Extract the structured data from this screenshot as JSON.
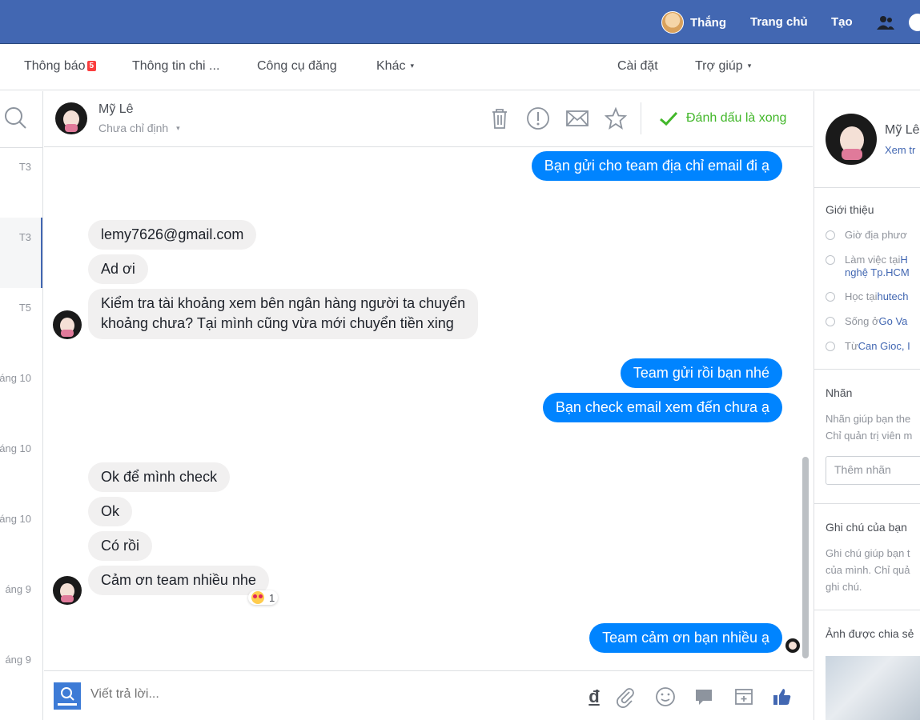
{
  "topbar": {
    "user_name": "Thắng",
    "nav": [
      "Trang chủ",
      "Tạo"
    ]
  },
  "subnav": {
    "items": [
      {
        "label": "Thông báo",
        "badge": "5"
      },
      {
        "label": "Thông tin chi ..."
      },
      {
        "label": "Công cụ đăng"
      },
      {
        "label": "Khác",
        "caret": "▾"
      },
      {
        "label": "Cài đặt"
      },
      {
        "label": "Trợ giúp",
        "caret": "▾"
      }
    ]
  },
  "threadlist": {
    "dates": [
      "T3",
      "T3",
      "T5",
      "áng 10",
      "áng 10",
      "áng 10",
      "áng 9",
      "áng 9"
    ]
  },
  "chat": {
    "contact_name": "Mỹ Lê",
    "assign_label": "Chưa chỉ định",
    "assign_caret": "▾",
    "mark_done": "Đánh dấu là xong"
  },
  "messages": [
    {
      "dir": "out",
      "text": "Bạn gửi cho team địa chỉ email đi ạ"
    },
    {
      "dir": "in",
      "text": "lemy7626@gmail.com"
    },
    {
      "dir": "in",
      "text": "Ad ơi"
    },
    {
      "dir": "in",
      "text": "Kiểm tra tài khoảng xem bên ngân hàng người ta chuyển"
    },
    {
      "dir": "in",
      "text": "khoảng chưa? Tại mình cũng vừa mới chuyển tiền xing"
    },
    {
      "dir": "out",
      "text": "Team gửi rồi bạn nhé"
    },
    {
      "dir": "out",
      "text": "Bạn check email xem đến chưa ạ"
    },
    {
      "dir": "in",
      "text": "Ok để mình check"
    },
    {
      "dir": "in",
      "text": "Ok"
    },
    {
      "dir": "in",
      "text": "Có rồi"
    },
    {
      "dir": "in",
      "text": "Cảm ơn team nhiều nhe"
    },
    {
      "dir": "out",
      "text": "Team cảm ơn bạn nhiều ạ"
    }
  ],
  "reaction": {
    "count": "1"
  },
  "composer": {
    "placeholder": "Viết trả lời...",
    "currency_symbol": "đ"
  },
  "profile": {
    "name": "Mỹ Lê",
    "link": "Xem tr",
    "intro_title": "Giới thiệu",
    "intro": [
      {
        "prefix": "Giờ địa phươ",
        "link": ""
      },
      {
        "prefix": "Làm việc tại ",
        "link": "H"
      },
      {
        "prefix": "",
        "link": "nghệ Tp.HCM"
      },
      {
        "prefix": "Học tại ",
        "link": "hutech"
      },
      {
        "prefix": "Sống ở ",
        "link": "Go Va"
      },
      {
        "prefix": "Từ ",
        "link": "Can Gioc, I"
      }
    ],
    "tags_title": "Nhãn",
    "tags_desc_1": "Nhãn giúp bạn the",
    "tags_desc_2": "Chỉ quản trị viên m",
    "tags_placeholder": "Thêm nhãn",
    "notes_title": "Ghi chú của bạn",
    "notes_desc_1": "Ghi chú giúp bạn t",
    "notes_desc_2": "của mình. Chỉ quả",
    "notes_desc_3": "ghi chú.",
    "photos_title": "Ảnh được chia sẻ"
  },
  "colors": {
    "brand": "#4267b2",
    "outgoing": "#0084ff",
    "incoming": "#f1f0f0",
    "done": "#42b72a"
  }
}
